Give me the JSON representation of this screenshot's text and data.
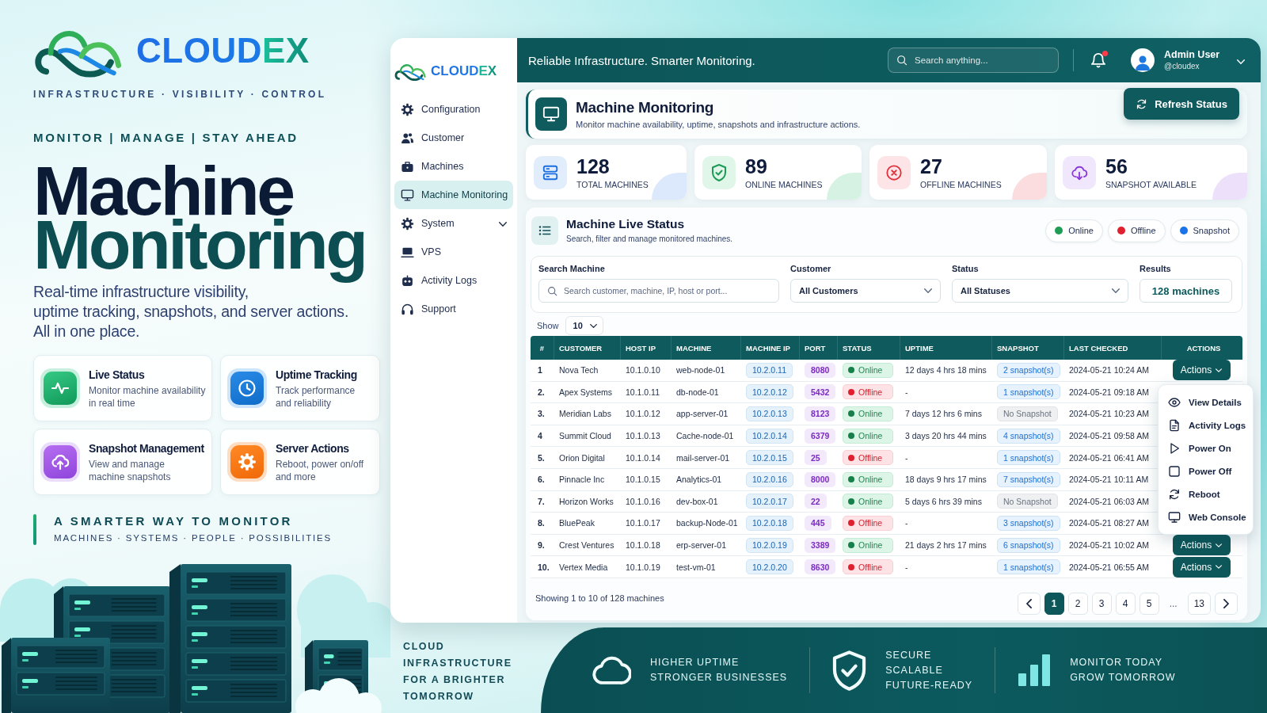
{
  "brand": {
    "name": "CLOUDEX",
    "tagline": "INFRASTRUCTURE · VISIBILITY · CONTROL"
  },
  "motto": "MONITOR | MANAGE | STAY AHEAD",
  "headline": [
    "Machine",
    "Monitoring"
  ],
  "intro": [
    "Real-time infrastructure visibility,",
    "uptime tracking, snapshots, and server actions.",
    "All in one place."
  ],
  "features": [
    {
      "title": "Live Status",
      "description": [
        "Monitor machine availability",
        "in real time"
      ]
    },
    {
      "title": "Uptime Tracking",
      "description": [
        "Track performance",
        "and reliability"
      ]
    },
    {
      "title": "Snapshot Management",
      "description": [
        "View and manage",
        "machine snapshots"
      ]
    },
    {
      "title": "Server Actions",
      "description": [
        "Reboot, power on/off",
        "and more"
      ]
    }
  ],
  "smarter": {
    "title": "A SMARTER WAY TO MONITOR",
    "subtitle": "MACHINES · SYSTEMS · PEOPLE · POSSIBILITIES"
  },
  "cloud_tagline": [
    "CLOUD",
    "INFRASTRUCTURE",
    "FOR A BRIGHTER",
    "TOMORROW"
  ],
  "dashboard": {
    "sidebar": {
      "brand": "CLOUDEX",
      "items": [
        {
          "label": "Configuration",
          "kind": "link",
          "selected": false
        },
        {
          "label": "Customer",
          "kind": "link",
          "selected": false
        },
        {
          "label": "Machines",
          "kind": "link",
          "selected": false
        },
        {
          "label": "Machine Monitoring",
          "kind": "link",
          "selected": true
        },
        {
          "label": "System",
          "kind": "group",
          "selected": false
        },
        {
          "label": "VPS",
          "kind": "link",
          "selected": false
        },
        {
          "label": "Activity Logs",
          "kind": "link",
          "selected": false
        },
        {
          "label": "Support",
          "kind": "link",
          "selected": false
        }
      ]
    },
    "header": {
      "tagline": "Reliable Infrastructure. Smarter Monitoring.",
      "search_placeholder": "Search anything...",
      "unread_notifications": true,
      "user": {
        "name": "Admin User",
        "handle": "@cloudex"
      }
    },
    "page": {
      "title": "Machine Monitoring",
      "subtitle": "Monitor machine availability, uptime, snapshots and infrastructure actions.",
      "refresh_button": "Refresh Status"
    },
    "stats": [
      {
        "value": "128",
        "label": "TOTAL MACHINES"
      },
      {
        "value": "89",
        "label": "ONLINE MACHINES"
      },
      {
        "value": "27",
        "label": "OFFLINE MACHINES"
      },
      {
        "value": "56",
        "label": "SNAPSHOT AVAILABLE"
      }
    ],
    "live_status": {
      "title": "Machine Live Status",
      "subtitle": "Search, filter and manage monitored machines.",
      "legend": [
        {
          "label": "Online",
          "color": "#1f9d55"
        },
        {
          "label": "Offline",
          "color": "#e0202f"
        },
        {
          "label": "Snapshot",
          "color": "#1a73e8"
        }
      ],
      "filters": {
        "search": {
          "label": "Search Machine",
          "placeholder": "Search customer, machine, IP, host or port..."
        },
        "customer": {
          "label": "Customer",
          "value": "All Customers"
        },
        "status": {
          "label": "Status",
          "value": "All Statuses"
        },
        "results": {
          "label": "Results",
          "value": "128 machines"
        }
      },
      "page_size": {
        "label": "Show",
        "value": "10"
      },
      "table": {
        "columns": [
          "#",
          "CUSTOMER",
          "HOST IP",
          "MACHINE",
          "MACHINE IP",
          "PORT",
          "STATUS",
          "UPTIME",
          "SNAPSHOT",
          "LAST CHECKED",
          "ACTIONS"
        ],
        "rows": [
          {
            "index": "1",
            "customer": "Nova Tech",
            "host_ip": "10.1.0.10",
            "machine": "web-node-01",
            "machine_ip": "10.2.0.11",
            "port": "8080",
            "status": {
              "kind": "online",
              "label": "Online"
            },
            "uptime": "12 days 4 hrs 18 mins",
            "snapshot": {
              "kind": "count",
              "label": "2 snapshot(s)"
            },
            "last_checked": "2024-05-21 10:24 AM",
            "action": "Actions"
          },
          {
            "index": "2.",
            "customer": "Apex Systems",
            "host_ip": "10.1.0.11",
            "machine": "db-node-01",
            "machine_ip": "10.2.0.12",
            "port": "5432",
            "status": {
              "kind": "offline",
              "label": "Offline"
            },
            "uptime": "-",
            "snapshot": {
              "kind": "count",
              "label": "1 snapshot(s)"
            },
            "last_checked": "2024-05-21 09:18 AM"
          },
          {
            "index": "3.",
            "customer": "Meridian Labs",
            "host_ip": "10.1.0.12",
            "machine": "app-server-01",
            "machine_ip": "10.2.0.13",
            "port": "8123",
            "status": {
              "kind": "online",
              "label": "Online"
            },
            "uptime": "7 days 12 hrs 6 mins",
            "snapshot": {
              "kind": "none",
              "label": "No Snapshot"
            },
            "last_checked": "2024-05-21 10:23 AM"
          },
          {
            "index": "4",
            "customer": "Summit Cloud",
            "host_ip": "10.1.0.13",
            "machine": "Cache-node-01",
            "machine_ip": "10.2.0.14",
            "port": "6379",
            "status": {
              "kind": "online",
              "label": "Online"
            },
            "uptime": "3 days 20 hrs 44 mins",
            "snapshot": {
              "kind": "count",
              "label": "4 snapshot(s)"
            },
            "last_checked": "2024-05-21 09:58 AM"
          },
          {
            "index": "5.",
            "customer": "Orion Digital",
            "host_ip": "10.1.0.14",
            "machine": "mail-server-01",
            "machine_ip": "10.2.0.15",
            "port": "25",
            "status": {
              "kind": "offline",
              "label": "Offline"
            },
            "uptime": "-",
            "snapshot": {
              "kind": "count",
              "label": "1 snapshot(s)"
            },
            "last_checked": "2024-05-21 06:41 AM"
          },
          {
            "index": "6.",
            "customer": "Pinnacle Inc",
            "host_ip": "10.1.0.15",
            "machine": "Analytics-01",
            "machine_ip": "10.2.0.16",
            "port": "8000",
            "status": {
              "kind": "online",
              "label": "Online"
            },
            "uptime": "18 days 9 hrs 17 mins",
            "snapshot": {
              "kind": "count",
              "label": "7 snapshot(s)"
            },
            "last_checked": "2024-05-21 10:11 AM"
          },
          {
            "index": "7.",
            "customer": "Horizon Works",
            "host_ip": "10.1.0.16",
            "machine": "dev-box-01",
            "machine_ip": "10.2.0.17",
            "port": "22",
            "status": {
              "kind": "online",
              "label": "Online"
            },
            "uptime": "5 days 6 hrs 39 mins",
            "snapshot": {
              "kind": "none",
              "label": "No Snapshot"
            },
            "last_checked": "2024-05-21 06:03 AM"
          },
          {
            "index": "8.",
            "customer": "BluePeak",
            "host_ip": "10.1.0.17",
            "machine": "backup-Node-01",
            "machine_ip": "10.2.0.18",
            "port": "445",
            "status": {
              "kind": "offline",
              "label": "Offline"
            },
            "uptime": "-",
            "snapshot": {
              "kind": "count",
              "label": "3 snapshot(s)"
            },
            "last_checked": "2024-05-21 08:27 AM"
          },
          {
            "index": "9.",
            "customer": "Crest Ventures",
            "host_ip": "10.1.0.18",
            "machine": "erp-server-01",
            "machine_ip": "10.2.0.19",
            "port": "3389",
            "status": {
              "kind": "online",
              "label": "Online"
            },
            "uptime": "21 days 2 hrs 17 mins",
            "snapshot": {
              "kind": "count",
              "label": "6 snapshot(s)"
            },
            "last_checked": "2024-05-21 10:02 AM",
            "action": "Actions"
          },
          {
            "index": "10.",
            "customer": "Vertex Media",
            "host_ip": "10.1.0.19",
            "machine": "test-vm-01",
            "machine_ip": "10.2.0.20",
            "port": "8630",
            "status": {
              "kind": "offline",
              "label": "Offline"
            },
            "uptime": "-",
            "snapshot": {
              "kind": "count",
              "label": "1 snapshot(s)"
            },
            "last_checked": "2024-05-21 06:55 AM",
            "action": "Actions"
          }
        ]
      },
      "action_menu": [
        "View Details",
        "Activity Logs",
        "Power On",
        "Power Off",
        "Reboot",
        "Web Console"
      ],
      "footer": "Showing 1 to 10 of 128 machines",
      "pagination": [
        {
          "kind": "page",
          "label": "1",
          "selected": true
        },
        {
          "kind": "page",
          "label": "2",
          "selected": false
        },
        {
          "kind": "page",
          "label": "3",
          "selected": false
        },
        {
          "kind": "page",
          "label": "4",
          "selected": false
        },
        {
          "kind": "page",
          "label": "5",
          "selected": false
        },
        {
          "kind": "ellipsis",
          "label": "...",
          "selected": false
        },
        {
          "kind": "page",
          "label": "13",
          "selected": false
        }
      ]
    }
  },
  "band": [
    {
      "lines": [
        "HIGHER UPTIME",
        "STRONGER BUSINESSES"
      ]
    },
    {
      "lines": [
        "SECURE",
        "SCALABLE",
        "FUTURE-READY"
      ]
    },
    {
      "lines": [
        "MONITOR TODAY",
        "GROW TOMORROW"
      ]
    }
  ]
}
